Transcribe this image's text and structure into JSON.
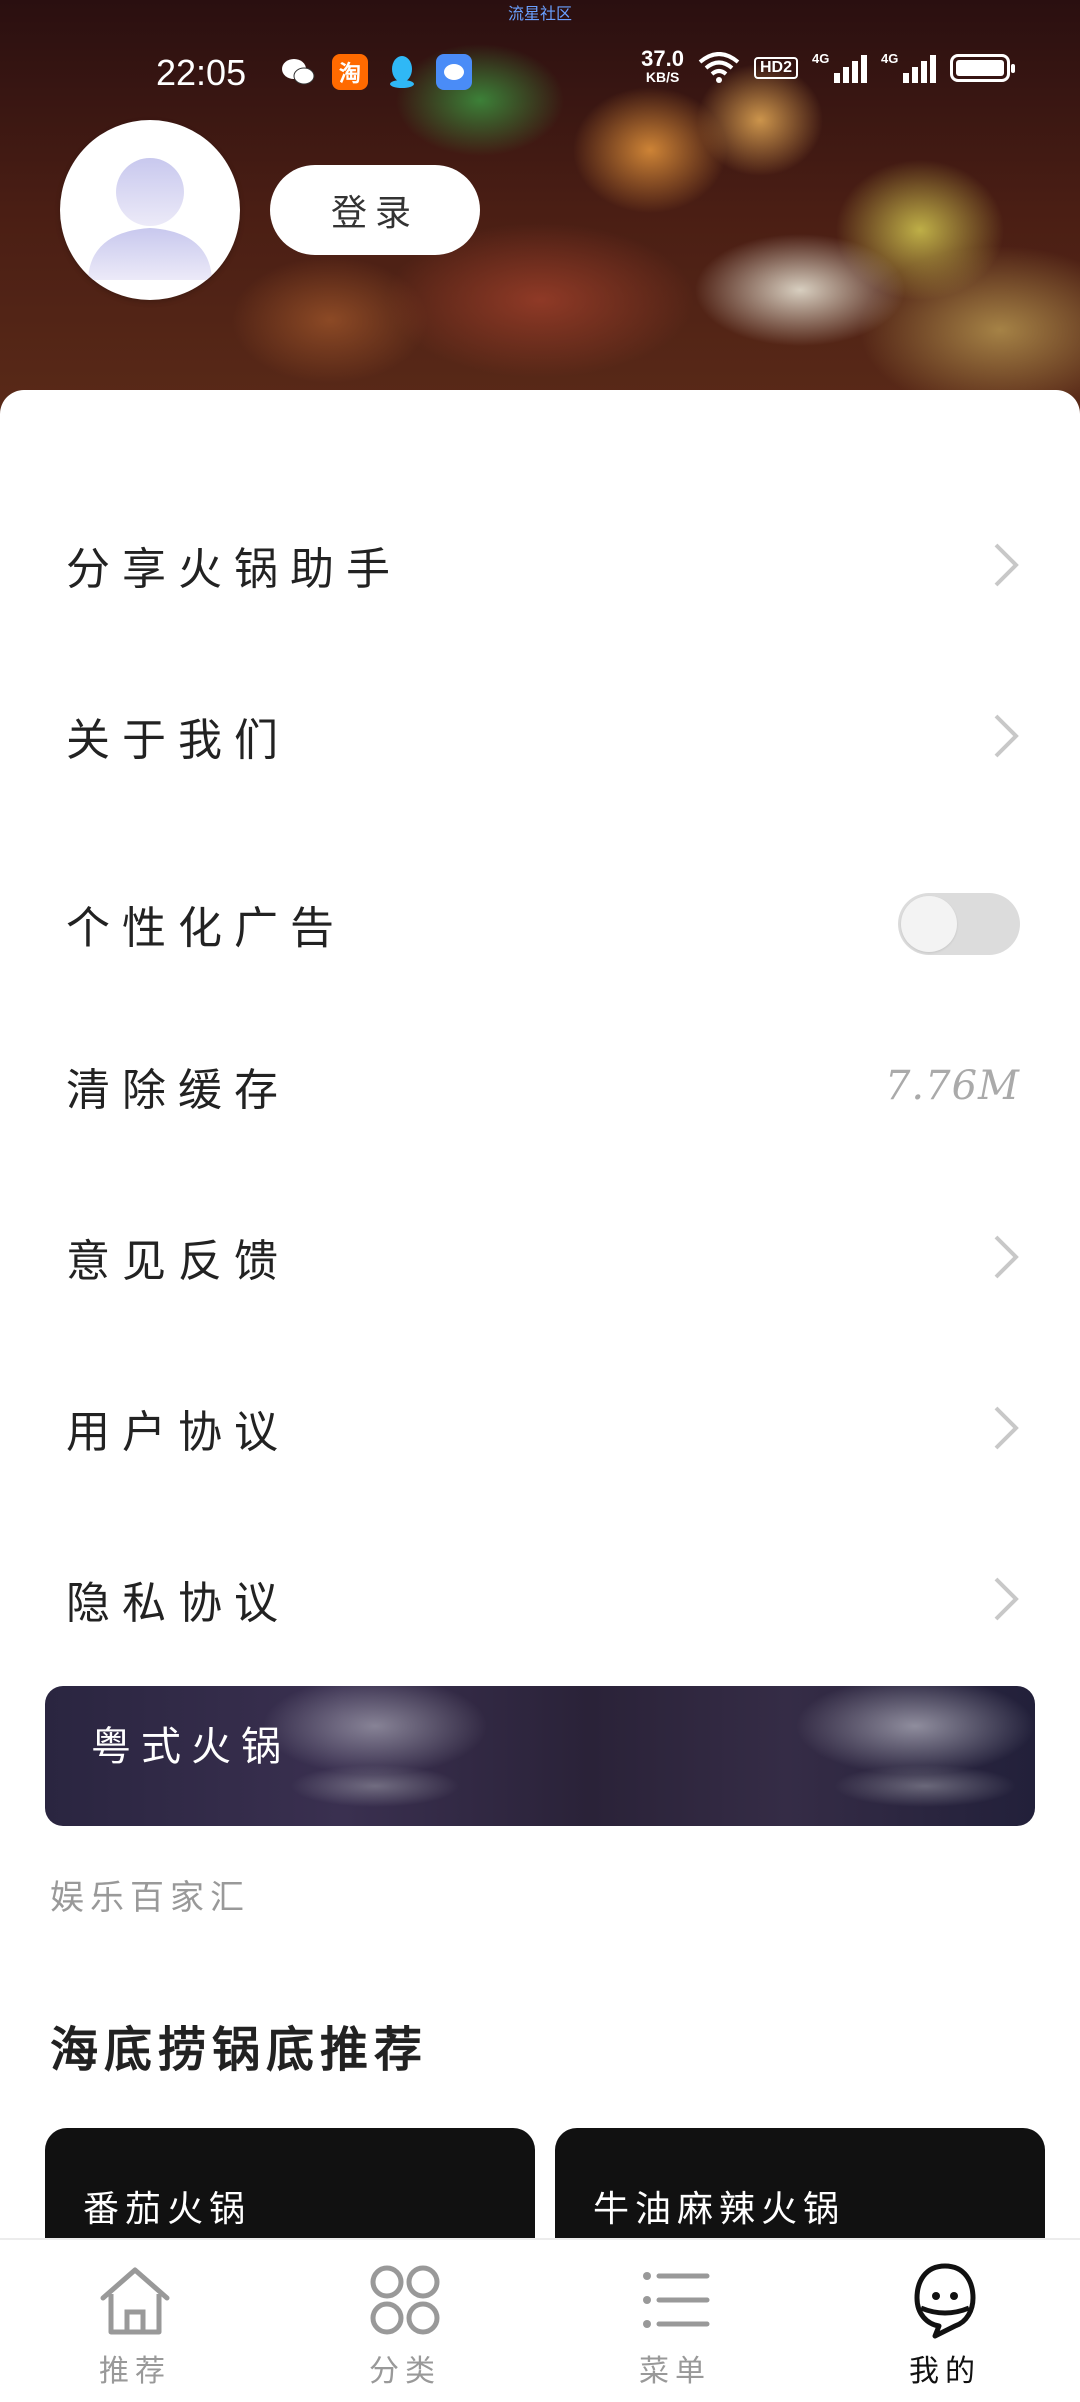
{
  "status_bar": {
    "top_label": "流星社区",
    "time": "22:05",
    "speed_value": "37.0",
    "speed_unit": "KB/S",
    "hd_label": "HD2",
    "network_1": "4G",
    "network_2": "4G",
    "app_icons": [
      "wechat-icon",
      "taobao-icon",
      "qq-icon",
      "message-icon"
    ],
    "taobao_glyph": "淘"
  },
  "profile": {
    "login_label": "登录"
  },
  "menu": {
    "share_label": "分享火锅助手",
    "about_label": "关于我们",
    "ads_label": "个性化广告",
    "ads_enabled": false,
    "cache_label": "清除缓存",
    "cache_value": "7.76M",
    "feedback_label": "意见反馈",
    "user_agreement_label": "用户协议",
    "privacy_label": "隐私协议"
  },
  "banner": {
    "label": "粤式火锅"
  },
  "section": {
    "caption": "娱乐百家汇",
    "title": "海底捞锅底推荐",
    "cards": [
      {
        "label": "番茄火锅"
      },
      {
        "label": "牛油麻辣火锅"
      }
    ]
  },
  "bottom_nav": {
    "items": [
      {
        "label": "推荐",
        "icon": "home-icon"
      },
      {
        "label": "分类",
        "icon": "category-icon"
      },
      {
        "label": "菜单",
        "icon": "menu-list-icon"
      },
      {
        "label": "我的",
        "icon": "profile-icon",
        "active": true
      }
    ]
  },
  "colors": {
    "accent_text": "#222222",
    "muted_text": "#999999",
    "toggle_off": "#dcdcdc",
    "nav_active": "#111111"
  }
}
